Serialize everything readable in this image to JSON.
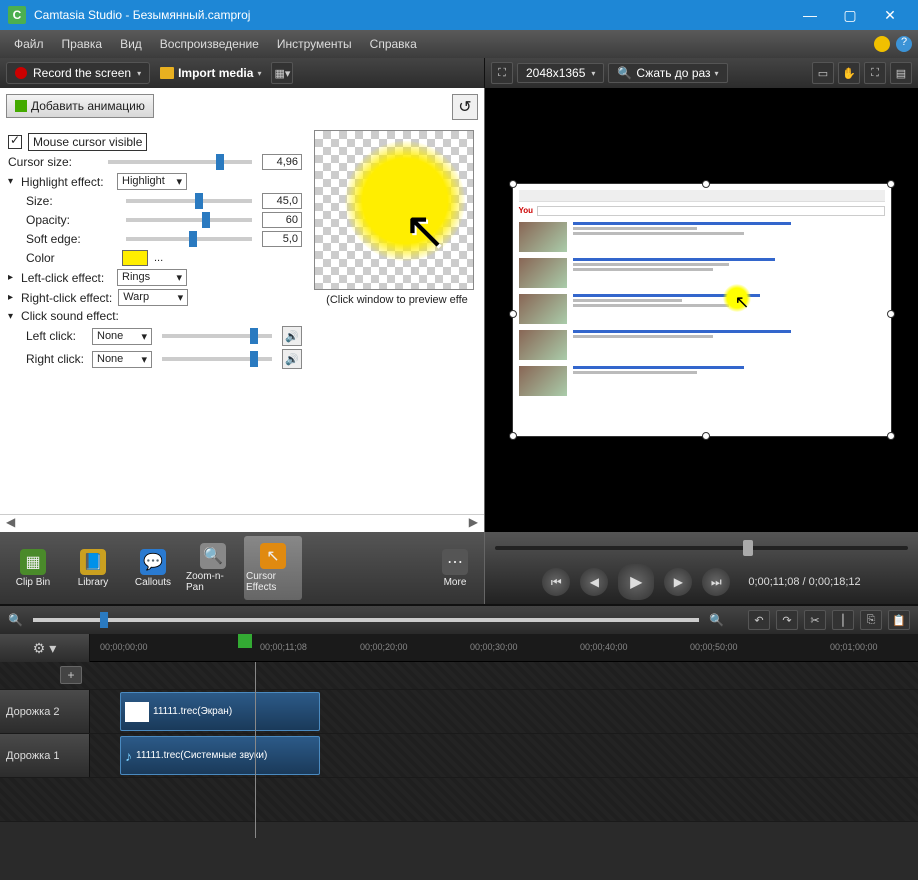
{
  "titlebar": {
    "app": "Camtasia Studio",
    "file": "Безымянный.camproj"
  },
  "menu": {
    "file": "Файл",
    "edit": "Правка",
    "view": "Вид",
    "play": "Воспроизведение",
    "tools": "Инструменты",
    "help": "Справка"
  },
  "toolbar": {
    "record": "Record the screen",
    "import": "Import media",
    "dimensions": "2048x1365",
    "zoom": "Сжать до раз"
  },
  "fx": {
    "addAnim": "Добавить анимацию",
    "cursorVisible": "Mouse cursor visible",
    "cursorSize": "Cursor size:",
    "cursorSizeVal": "4,96",
    "highlight": "Highlight effect:",
    "highlightVal": "Highlight",
    "size": "Size:",
    "sizeVal": "45,0",
    "opacity": "Opacity:",
    "opacityVal": "60",
    "soft": "Soft edge:",
    "softVal": "5,0",
    "color": "Color",
    "leftClick": "Left-click effect:",
    "leftClickVal": "Rings",
    "rightClick": "Right-click effect:",
    "rightClickVal": "Warp",
    "clickSound": "Click sound effect:",
    "leftSound": "Left click:",
    "rightSound": "Right click:",
    "none": "None",
    "previewCap": "(Click window to preview effe"
  },
  "tabs": {
    "clipbin": "Clip Bin",
    "library": "Library",
    "callouts": "Callouts",
    "zoom": "Zoom-n-Pan",
    "cursor": "Cursor Effects",
    "more": "More"
  },
  "player": {
    "time": "0;00;11;08 / 0;00;18;12"
  },
  "timeline": {
    "labels": [
      "00;00;00;00",
      "00;00;11;08",
      "00;00;20;00",
      "00;00;30;00",
      "00;00;40;00",
      "00;00;50;00",
      "00;01;00;00"
    ],
    "track2": "Дорожка 2",
    "track1": "Дорожка 1",
    "clip2": "11111.trec(Экран)",
    "clip1": "11111.trec(Системные звуки)"
  }
}
